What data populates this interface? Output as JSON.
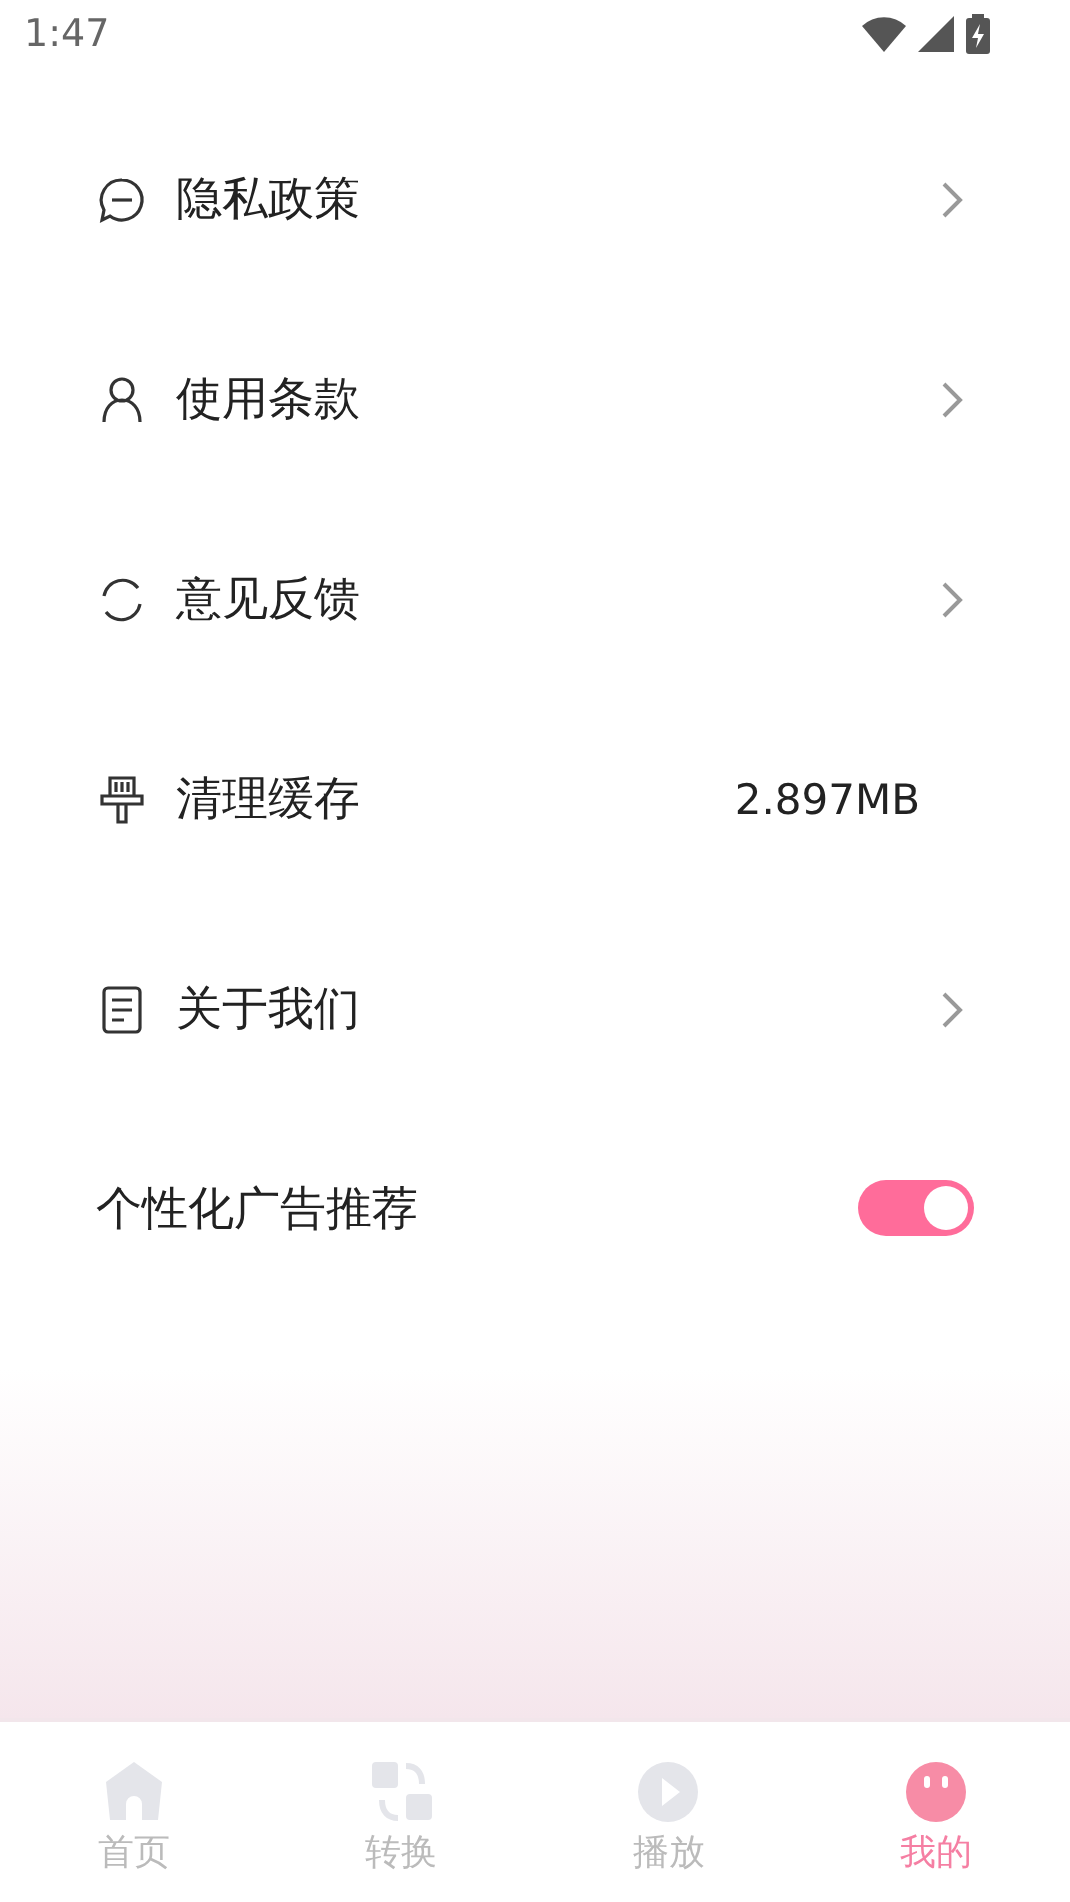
{
  "status_bar": {
    "time": "1:47"
  },
  "menu": [
    {
      "kind": "link",
      "label": "隐私政策"
    },
    {
      "kind": "link",
      "label": "使用条款"
    },
    {
      "kind": "link",
      "label": "意见反馈"
    },
    {
      "kind": "value",
      "label": "清理缓存",
      "value": "2.897MB"
    },
    {
      "kind": "link",
      "label": "关于我们"
    },
    {
      "kind": "toggle",
      "label": "个性化广告推荐",
      "on": true
    }
  ],
  "tab_bar": [
    {
      "label": "首页",
      "selected": false
    },
    {
      "label": "转换",
      "selected": false
    },
    {
      "label": "播放",
      "selected": false
    },
    {
      "label": "我的",
      "selected": true
    }
  ]
}
